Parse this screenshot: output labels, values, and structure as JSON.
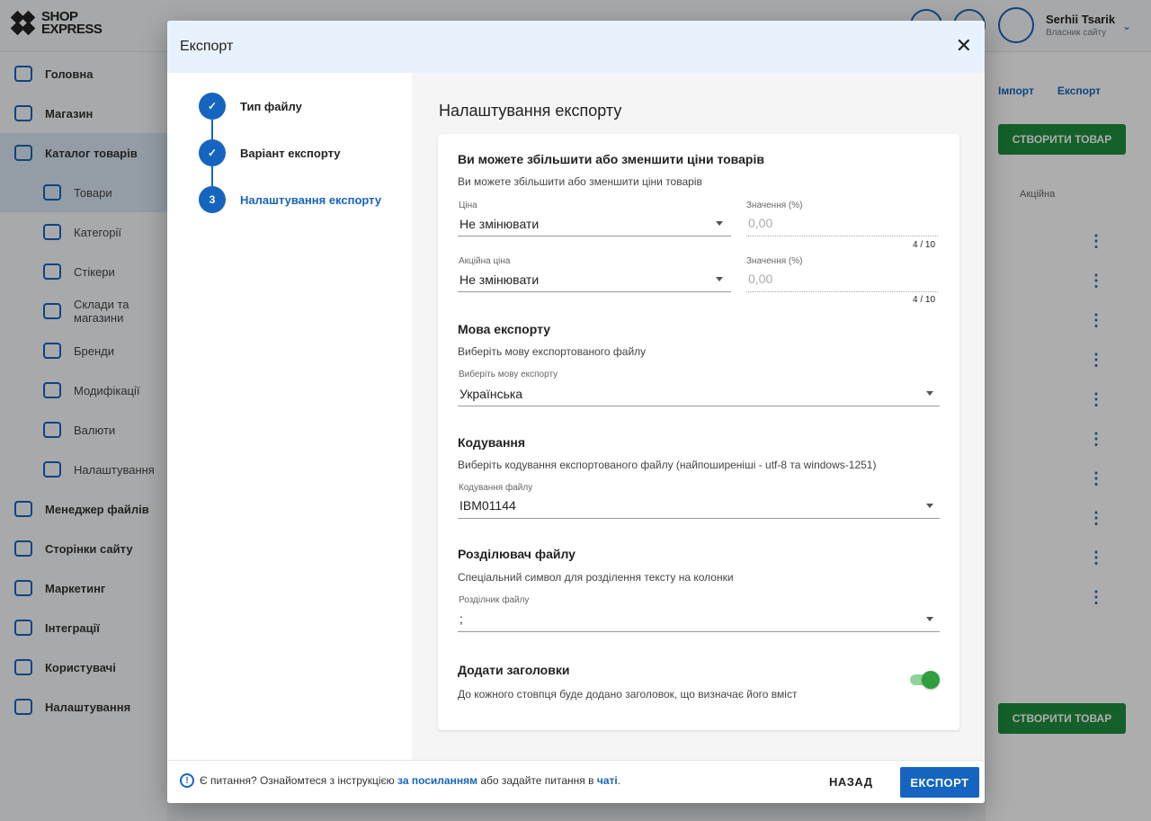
{
  "app": {
    "logo_line1": "SHOP",
    "logo_line2": "EXPRESS",
    "user_name": "Serhii Tsarik",
    "user_sub": "Власник сайту"
  },
  "sidebar": {
    "items": [
      {
        "label": "Головна",
        "icon": "home-icon"
      },
      {
        "label": "Магазин",
        "icon": "cart-icon"
      },
      {
        "label": "Каталог товарів",
        "icon": "catalog-icon"
      },
      {
        "label": "Товари",
        "icon": "box-icon"
      },
      {
        "label": "Категорії",
        "icon": "categories-icon"
      },
      {
        "label": "Стікери",
        "icon": "sticker-icon"
      },
      {
        "label": "Склади та магазини",
        "icon": "warehouse-icon"
      },
      {
        "label": "Бренди",
        "icon": "tag-icon"
      },
      {
        "label": "Модифікації",
        "icon": "modification-icon"
      },
      {
        "label": "Валюти",
        "icon": "currency-icon"
      },
      {
        "label": "Налаштування",
        "icon": "gear-icon"
      },
      {
        "label": "Менеджер файлів",
        "icon": "folder-icon"
      },
      {
        "label": "Сторінки сайту",
        "icon": "pages-icon"
      },
      {
        "label": "Маркетинг",
        "icon": "marketing-icon"
      },
      {
        "label": "Інтеграції",
        "icon": "integration-icon"
      },
      {
        "label": "Користувачі",
        "icon": "users-icon"
      },
      {
        "label": "Налаштування",
        "icon": "settings-icon"
      }
    ]
  },
  "background_page": {
    "import_label": "Імпорт",
    "export_label": "Експорт",
    "create_product_label": "СТВОРИТИ ТОВАР",
    "column_header": "Акційна"
  },
  "dialog": {
    "title": "Експорт",
    "steps": [
      {
        "label": "Тип файлу",
        "marker": "✓"
      },
      {
        "label": "Варіант експорту",
        "marker": "✓"
      },
      {
        "label": "Налаштування експорту",
        "marker": "3"
      }
    ],
    "content_title": "Налаштування експорту",
    "price_section": {
      "title": "Ви можете збільшити або зменшити ціни товарів",
      "description": "Ви можете збільшити або зменшити ціни товарів",
      "price_label": "Ціна",
      "price_value": "Не змінювати",
      "price_value_label": "Значення (%)",
      "price_value_placeholder": "0,00",
      "price_counter": "4 / 10",
      "sale_price_label": "Акційна ціна",
      "sale_price_value": "Не змінювати",
      "sale_value_label": "Значення (%)",
      "sale_value_placeholder": "0,00",
      "sale_counter": "4 / 10"
    },
    "language_section": {
      "title": "Мова експорту",
      "description": "Виберіть мову експортованого файлу",
      "field_label": "Виберіть мову експорту",
      "value": "Українська"
    },
    "encoding_section": {
      "title": "Кодування",
      "description": "Виберіть кодування експортованого файлу (найпоширеніші - utf-8 та windows-1251)",
      "field_label": "Кодування файлу",
      "value": "IBM01144"
    },
    "separator_section": {
      "title": "Розділювач файлу",
      "description": "Спеціальний символ для розділення тексту на колонки",
      "field_label": "Розділник файлу",
      "value": ";"
    },
    "headers_section": {
      "title": "Додати заголовки",
      "description": "До кожного стовпця буде додано заголовок, що визначає його вміст",
      "enabled": true
    },
    "footer": {
      "help_prefix": "Є питання? Ознайомтеся з інструкцією",
      "help_link1": "за посиланням",
      "help_middle": "або задайте питання в",
      "help_link2": "чаті",
      "help_suffix": ".",
      "back_label": "НАЗАД",
      "export_label": "ЕКСПОРТ"
    }
  },
  "colors": {
    "primary": "#1565c0",
    "success": "#2e9e3e",
    "header_bg": "#e8f2fc"
  }
}
